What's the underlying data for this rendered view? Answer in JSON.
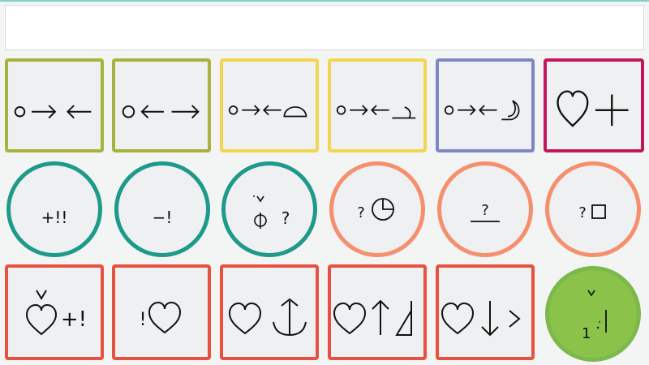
{
  "display": {
    "text": ""
  },
  "colors": {
    "olive": "#a8b33d",
    "yellow": "#f5d450",
    "lavender": "#7f86c6",
    "magenta": "#c2185b",
    "teal": "#1e9a8a",
    "salmon": "#f58f6e",
    "red": "#e8503f",
    "green_fill": "#8bc34a",
    "green_border": "#7cb84a"
  },
  "keys": [
    {
      "row": 1,
      "icons": [
        "ring-icon",
        "arrow-right-icon",
        "arrow-left-icon"
      ]
    },
    {
      "row": 1,
      "icons": [
        "ring-icon",
        "arrow-left-icon",
        "arrow-right-icon"
      ]
    },
    {
      "row": 1,
      "icons": [
        "ring-icon",
        "arrow-right-icon",
        "arrow-left-icon",
        "half-disc-icon"
      ]
    },
    {
      "row": 1,
      "icons": [
        "ring-icon",
        "arrow-right-icon",
        "arrow-left-icon",
        "crescent-flat-icon"
      ]
    },
    {
      "row": 1,
      "icons": [
        "ring-icon",
        "arrow-right-icon",
        "arrow-left-icon",
        "crescent-icon"
      ]
    },
    {
      "row": 1,
      "icons": [
        "heart-icon",
        "plus-icon"
      ]
    },
    {
      "row": 2,
      "label": "+!!"
    },
    {
      "row": 2,
      "label": "−!"
    },
    {
      "row": 2,
      "label": "?",
      "icons": [
        "phi-icon",
        "caret-icon"
      ]
    },
    {
      "row": 2,
      "label": "?",
      "icons": [
        "clock-icon"
      ]
    },
    {
      "row": 2,
      "label": "?",
      "icons": [
        "underline-icon"
      ]
    },
    {
      "row": 2,
      "label": "?",
      "icons": [
        "square-icon"
      ]
    },
    {
      "row": 3,
      "label": "+!",
      "icons": [
        "heart-icon",
        "caret-icon"
      ]
    },
    {
      "row": 3,
      "label": "!",
      "icons": [
        "heart-icon"
      ]
    },
    {
      "row": 3,
      "icons": [
        "heart-icon",
        "anchor-icon"
      ]
    },
    {
      "row": 3,
      "icons": [
        "heart-icon",
        "arrow-up-icon",
        "flag-icon"
      ]
    },
    {
      "row": 3,
      "icons": [
        "heart-icon",
        "arrow-down-icon",
        "chevron-right-icon"
      ]
    },
    {
      "row": 3,
      "label": "1",
      "icons": [
        "caret-icon",
        "dot-icon",
        "bar-icon"
      ]
    }
  ]
}
